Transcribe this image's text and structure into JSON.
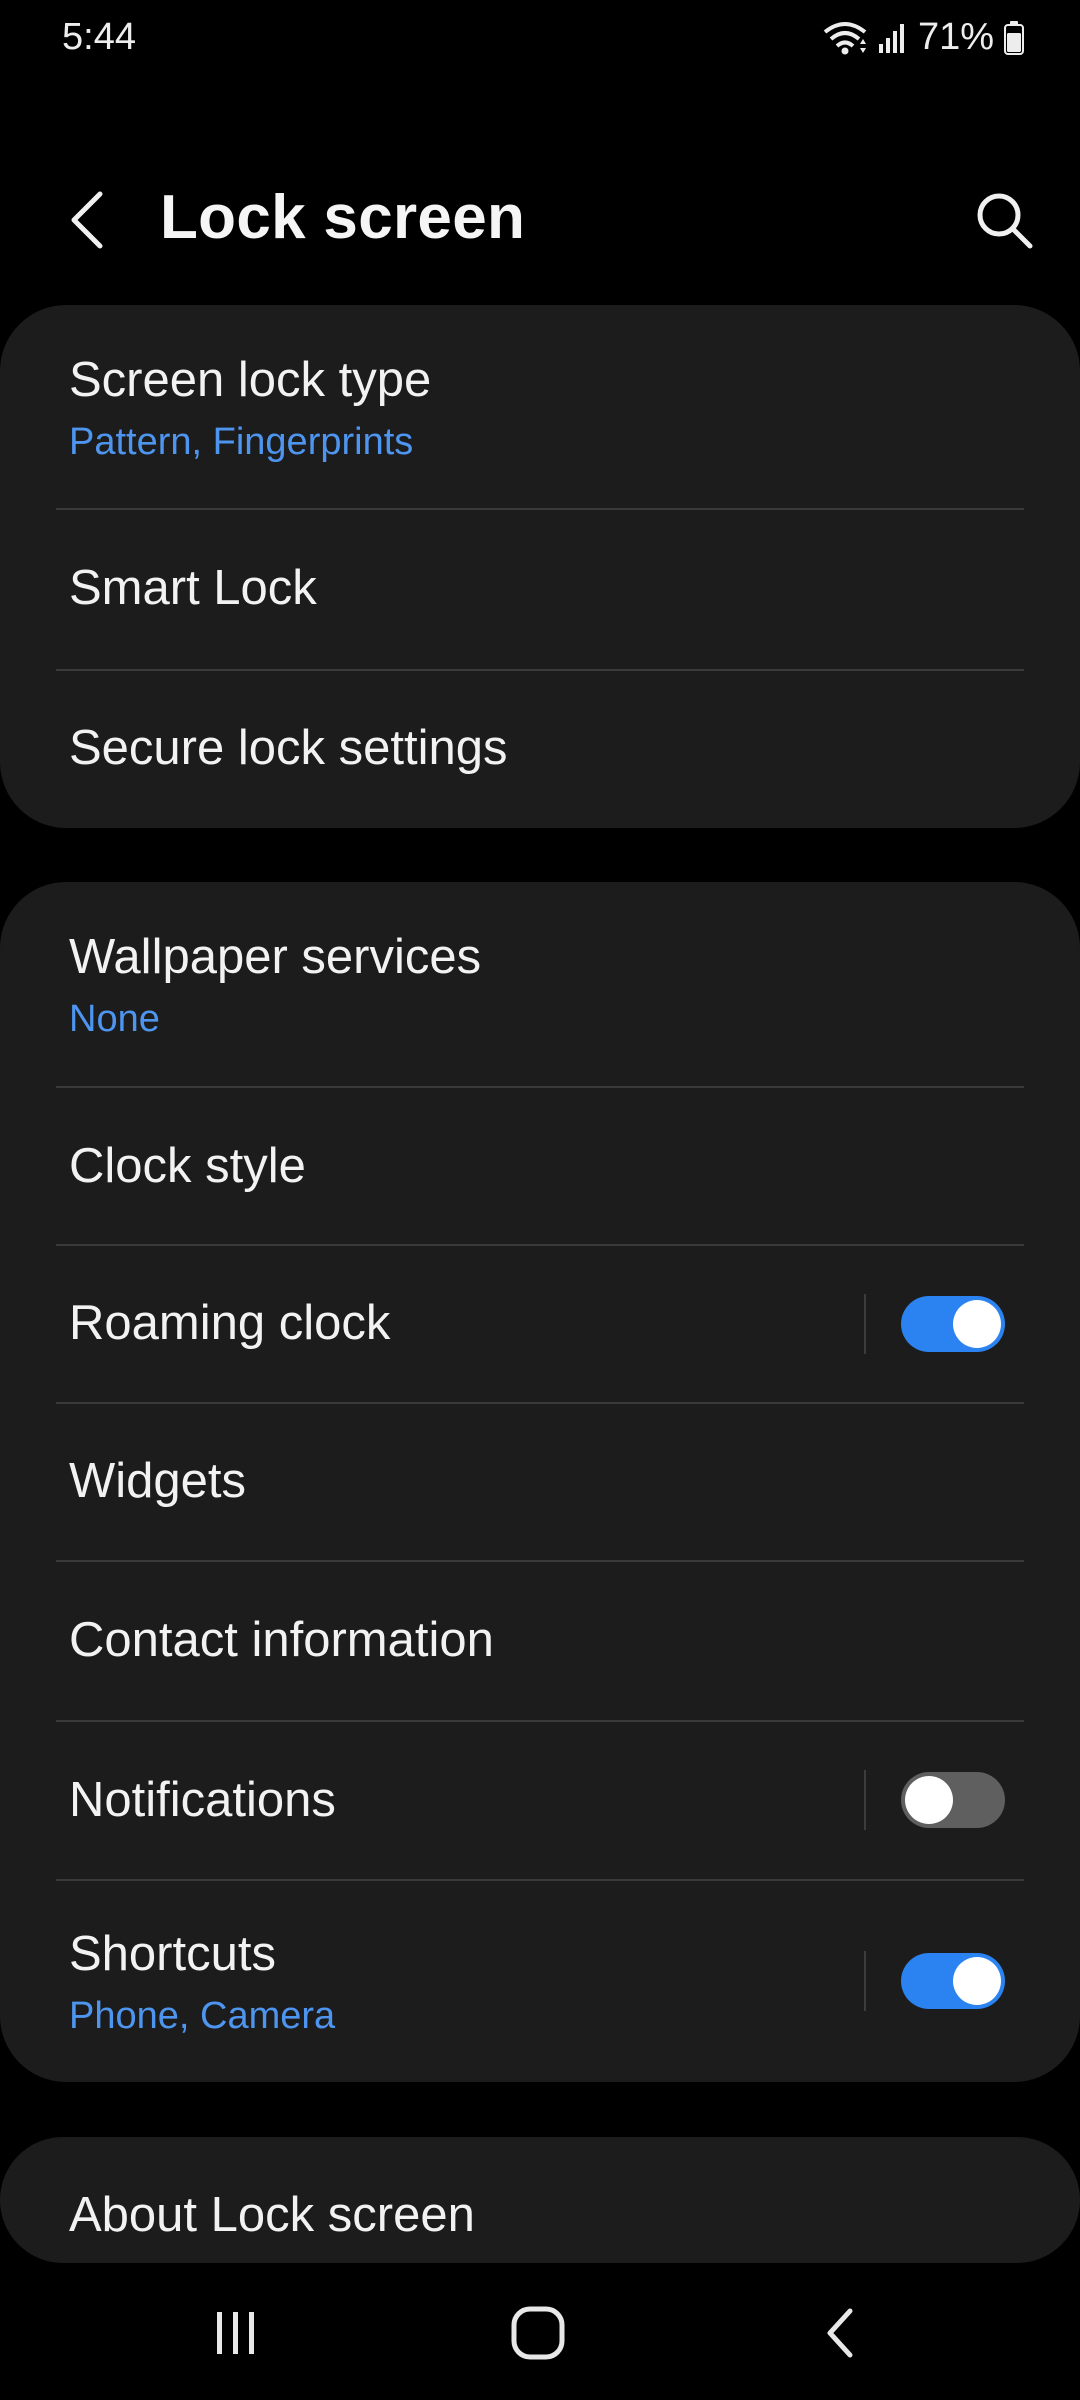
{
  "status_bar": {
    "time": "5:44",
    "battery_percent": "71%",
    "icons": [
      "wifi-icon",
      "signal-icon",
      "battery-icon"
    ]
  },
  "header": {
    "title": "Lock screen",
    "back_icon": "back-chevron-icon",
    "search_icon": "search-icon"
  },
  "colors": {
    "accent": "#2a83f0",
    "subtitle": "#4e95f0",
    "card_bg": "#1c1c1c",
    "background": "#000000"
  },
  "groups": [
    {
      "items": [
        {
          "title": "Screen lock type",
          "subtitle": "Pattern, Fingerprints"
        },
        {
          "title": "Smart Lock"
        },
        {
          "title": "Secure lock settings"
        }
      ]
    },
    {
      "items": [
        {
          "title": "Wallpaper services",
          "subtitle": "None"
        },
        {
          "title": "Clock style"
        },
        {
          "title": "Roaming clock",
          "toggle": true
        },
        {
          "title": "Widgets"
        },
        {
          "title": "Contact information"
        },
        {
          "title": "Notifications",
          "toggle": false
        },
        {
          "title": "Shortcuts",
          "subtitle": "Phone, Camera",
          "toggle": true
        }
      ]
    },
    {
      "items": [
        {
          "title": "About Lock screen"
        }
      ]
    }
  ],
  "nav_bar": {
    "icons": [
      "recent-apps-icon",
      "home-icon",
      "back-icon"
    ]
  }
}
